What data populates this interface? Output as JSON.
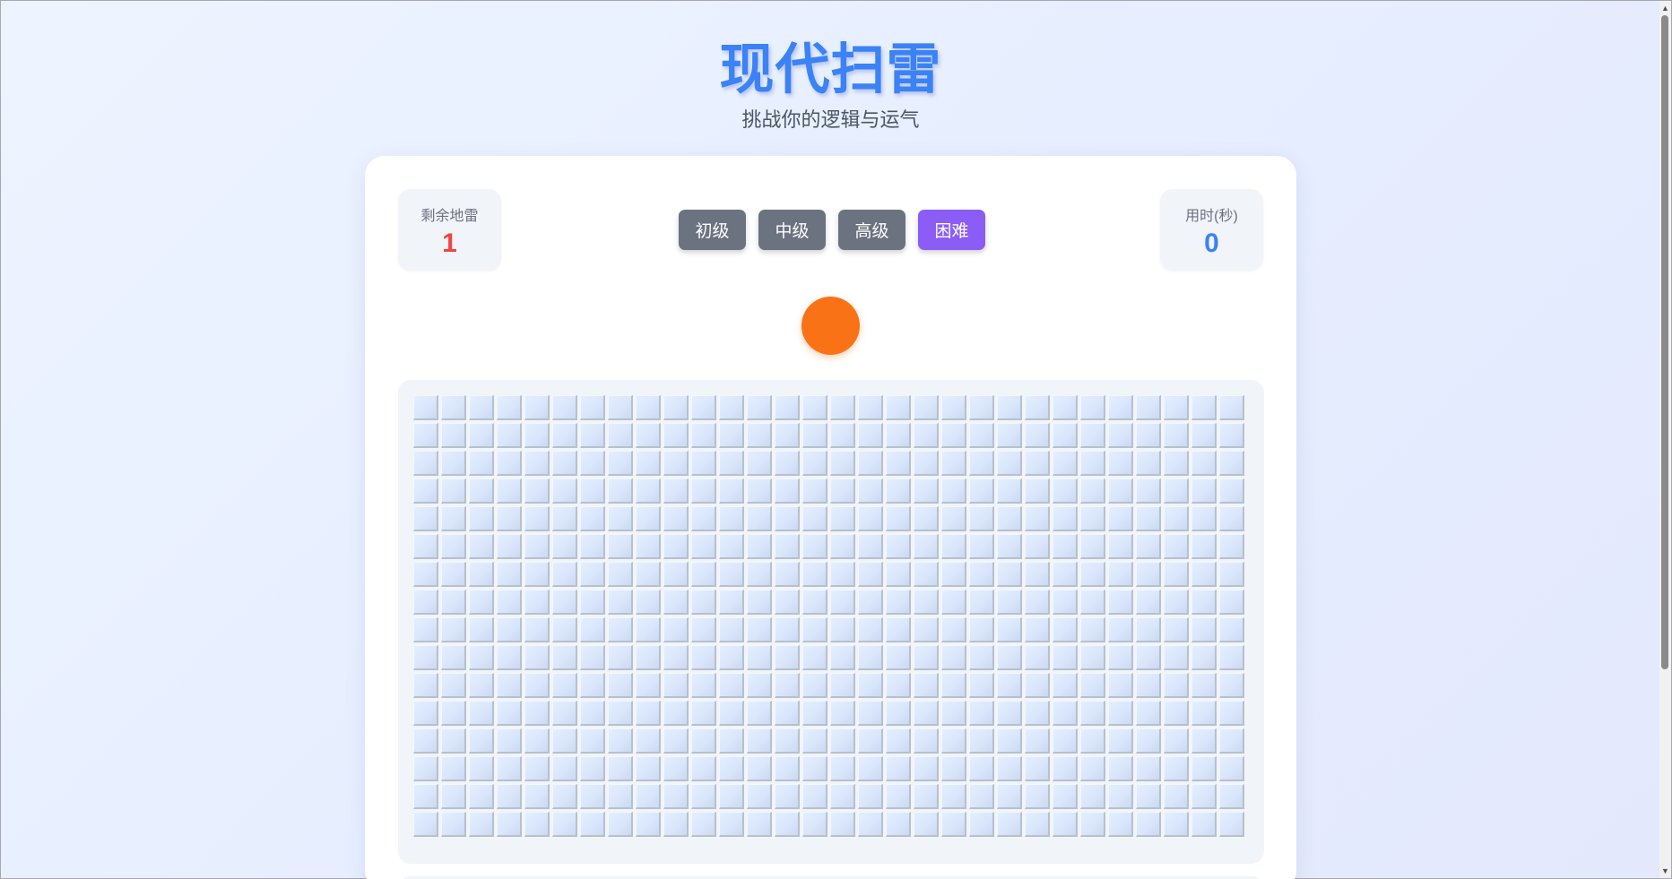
{
  "header": {
    "title": "现代扫雷",
    "subtitle": "挑战你的逻辑与运气"
  },
  "stats": {
    "mines_label": "剩余地雷",
    "mines_value": "1",
    "timer_label": "用时(秒)",
    "timer_value": "0"
  },
  "levels": [
    {
      "label": "初级",
      "active": false
    },
    {
      "label": "中级",
      "active": false
    },
    {
      "label": "高级",
      "active": false
    },
    {
      "label": "困难",
      "active": true
    }
  ],
  "board": {
    "columns": 30,
    "rows": 16,
    "state": "all-covered"
  },
  "colors": {
    "title": "#3b82f6",
    "mines_value": "#ef4444",
    "timer_value": "#3b82f6",
    "level_button": "#6b7280",
    "level_button_active": "#8b5cf6",
    "face_button": "#f97316"
  }
}
